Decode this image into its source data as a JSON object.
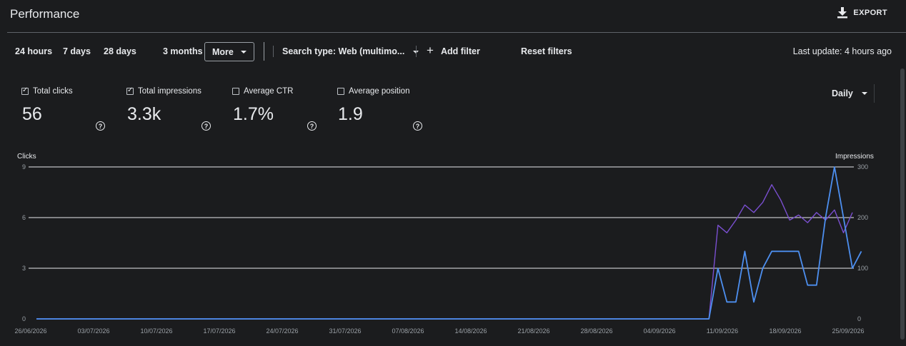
{
  "header": {
    "title": "Performance",
    "export_label": "EXPORT"
  },
  "filters": {
    "ranges": [
      "24 hours",
      "7 days",
      "28 days",
      "3 months"
    ],
    "more_label": "More",
    "search_type": "Search type: Web (multimo...",
    "add_filter": "Add filter",
    "reset": "Reset filters",
    "last_update": "Last update: 4 hours ago"
  },
  "metrics": [
    {
      "label": "Total clicks",
      "value": "56",
      "checked": true
    },
    {
      "label": "Total impressions",
      "value": "3.3k",
      "checked": true
    },
    {
      "label": "Average CTR",
      "value": "1.7%",
      "checked": false
    },
    {
      "label": "Average position",
      "value": "1.9",
      "checked": false
    }
  ],
  "granularity": "Daily",
  "colors": {
    "clicks": "#4d8ff0",
    "impressions": "#7a4fd0",
    "grid": "#e8eaed",
    "axis_text": "#9aa0a6"
  },
  "chart_data": {
    "type": "line",
    "left_axis_label": "Clicks",
    "right_axis_label": "Impressions",
    "left_ticks": [
      0,
      3,
      6,
      9
    ],
    "right_ticks": [
      0,
      100,
      200,
      300
    ],
    "ylim_left": [
      0,
      9
    ],
    "ylim_right": [
      0,
      300
    ],
    "x_tick_labels": [
      "26/06/2026",
      "03/07/2026",
      "10/07/2026",
      "17/07/2026",
      "24/07/2026",
      "31/07/2026",
      "07/08/2026",
      "14/08/2026",
      "21/08/2026",
      "28/08/2026",
      "04/09/2026",
      "11/09/2026",
      "18/09/2026",
      "25/09/2026"
    ],
    "x_start": "2026-06-26",
    "x_end": "2026-09-25",
    "grid": true,
    "series": [
      {
        "name": "Clicks",
        "axis": "left",
        "points": [
          [
            "2026-06-26",
            0
          ],
          [
            "2026-09-09",
            0
          ],
          [
            "2026-09-10",
            3
          ],
          [
            "2026-09-11",
            1
          ],
          [
            "2026-09-12",
            1
          ],
          [
            "2026-09-13",
            4
          ],
          [
            "2026-09-14",
            1
          ],
          [
            "2026-09-15",
            3
          ],
          [
            "2026-09-16",
            4
          ],
          [
            "2026-09-17",
            4
          ],
          [
            "2026-09-18",
            4
          ],
          [
            "2026-09-19",
            4
          ],
          [
            "2026-09-20",
            2
          ],
          [
            "2026-09-21",
            2
          ],
          [
            "2026-09-22",
            6
          ],
          [
            "2026-09-23",
            9
          ],
          [
            "2026-09-24",
            6
          ],
          [
            "2026-09-25",
            3
          ],
          [
            "2026-09-26",
            4
          ]
        ]
      },
      {
        "name": "Impressions",
        "axis": "right",
        "points": [
          [
            "2026-06-26",
            0
          ],
          [
            "2026-09-09",
            0
          ],
          [
            "2026-09-10",
            185
          ],
          [
            "2026-09-11",
            170
          ],
          [
            "2026-09-12",
            195
          ],
          [
            "2026-09-13",
            225
          ],
          [
            "2026-09-14",
            210
          ],
          [
            "2026-09-15",
            230
          ],
          [
            "2026-09-16",
            265
          ],
          [
            "2026-09-17",
            235
          ],
          [
            "2026-09-18",
            195
          ],
          [
            "2026-09-19",
            205
          ],
          [
            "2026-09-20",
            190
          ],
          [
            "2026-09-21",
            210
          ],
          [
            "2026-09-22",
            195
          ],
          [
            "2026-09-23",
            215
          ],
          [
            "2026-09-24",
            170
          ],
          [
            "2026-09-25",
            210
          ]
        ]
      }
    ]
  }
}
